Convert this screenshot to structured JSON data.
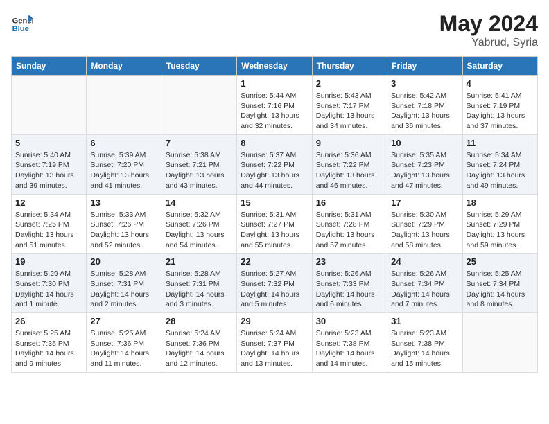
{
  "header": {
    "logo_line1": "General",
    "logo_line2": "Blue",
    "month_year": "May 2024",
    "location": "Yabrud, Syria"
  },
  "weekdays": [
    "Sunday",
    "Monday",
    "Tuesday",
    "Wednesday",
    "Thursday",
    "Friday",
    "Saturday"
  ],
  "weeks": [
    [
      {
        "day": "",
        "info": ""
      },
      {
        "day": "",
        "info": ""
      },
      {
        "day": "",
        "info": ""
      },
      {
        "day": "1",
        "info": "Sunrise: 5:44 AM\nSunset: 7:16 PM\nDaylight: 13 hours\nand 32 minutes."
      },
      {
        "day": "2",
        "info": "Sunrise: 5:43 AM\nSunset: 7:17 PM\nDaylight: 13 hours\nand 34 minutes."
      },
      {
        "day": "3",
        "info": "Sunrise: 5:42 AM\nSunset: 7:18 PM\nDaylight: 13 hours\nand 36 minutes."
      },
      {
        "day": "4",
        "info": "Sunrise: 5:41 AM\nSunset: 7:19 PM\nDaylight: 13 hours\nand 37 minutes."
      }
    ],
    [
      {
        "day": "5",
        "info": "Sunrise: 5:40 AM\nSunset: 7:19 PM\nDaylight: 13 hours\nand 39 minutes."
      },
      {
        "day": "6",
        "info": "Sunrise: 5:39 AM\nSunset: 7:20 PM\nDaylight: 13 hours\nand 41 minutes."
      },
      {
        "day": "7",
        "info": "Sunrise: 5:38 AM\nSunset: 7:21 PM\nDaylight: 13 hours\nand 43 minutes."
      },
      {
        "day": "8",
        "info": "Sunrise: 5:37 AM\nSunset: 7:22 PM\nDaylight: 13 hours\nand 44 minutes."
      },
      {
        "day": "9",
        "info": "Sunrise: 5:36 AM\nSunset: 7:22 PM\nDaylight: 13 hours\nand 46 minutes."
      },
      {
        "day": "10",
        "info": "Sunrise: 5:35 AM\nSunset: 7:23 PM\nDaylight: 13 hours\nand 47 minutes."
      },
      {
        "day": "11",
        "info": "Sunrise: 5:34 AM\nSunset: 7:24 PM\nDaylight: 13 hours\nand 49 minutes."
      }
    ],
    [
      {
        "day": "12",
        "info": "Sunrise: 5:34 AM\nSunset: 7:25 PM\nDaylight: 13 hours\nand 51 minutes."
      },
      {
        "day": "13",
        "info": "Sunrise: 5:33 AM\nSunset: 7:26 PM\nDaylight: 13 hours\nand 52 minutes."
      },
      {
        "day": "14",
        "info": "Sunrise: 5:32 AM\nSunset: 7:26 PM\nDaylight: 13 hours\nand 54 minutes."
      },
      {
        "day": "15",
        "info": "Sunrise: 5:31 AM\nSunset: 7:27 PM\nDaylight: 13 hours\nand 55 minutes."
      },
      {
        "day": "16",
        "info": "Sunrise: 5:31 AM\nSunset: 7:28 PM\nDaylight: 13 hours\nand 57 minutes."
      },
      {
        "day": "17",
        "info": "Sunrise: 5:30 AM\nSunset: 7:29 PM\nDaylight: 13 hours\nand 58 minutes."
      },
      {
        "day": "18",
        "info": "Sunrise: 5:29 AM\nSunset: 7:29 PM\nDaylight: 13 hours\nand 59 minutes."
      }
    ],
    [
      {
        "day": "19",
        "info": "Sunrise: 5:29 AM\nSunset: 7:30 PM\nDaylight: 14 hours\nand 1 minute."
      },
      {
        "day": "20",
        "info": "Sunrise: 5:28 AM\nSunset: 7:31 PM\nDaylight: 14 hours\nand 2 minutes."
      },
      {
        "day": "21",
        "info": "Sunrise: 5:28 AM\nSunset: 7:31 PM\nDaylight: 14 hours\nand 3 minutes."
      },
      {
        "day": "22",
        "info": "Sunrise: 5:27 AM\nSunset: 7:32 PM\nDaylight: 14 hours\nand 5 minutes."
      },
      {
        "day": "23",
        "info": "Sunrise: 5:26 AM\nSunset: 7:33 PM\nDaylight: 14 hours\nand 6 minutes."
      },
      {
        "day": "24",
        "info": "Sunrise: 5:26 AM\nSunset: 7:34 PM\nDaylight: 14 hours\nand 7 minutes."
      },
      {
        "day": "25",
        "info": "Sunrise: 5:25 AM\nSunset: 7:34 PM\nDaylight: 14 hours\nand 8 minutes."
      }
    ],
    [
      {
        "day": "26",
        "info": "Sunrise: 5:25 AM\nSunset: 7:35 PM\nDaylight: 14 hours\nand 9 minutes."
      },
      {
        "day": "27",
        "info": "Sunrise: 5:25 AM\nSunset: 7:36 PM\nDaylight: 14 hours\nand 11 minutes."
      },
      {
        "day": "28",
        "info": "Sunrise: 5:24 AM\nSunset: 7:36 PM\nDaylight: 14 hours\nand 12 minutes."
      },
      {
        "day": "29",
        "info": "Sunrise: 5:24 AM\nSunset: 7:37 PM\nDaylight: 14 hours\nand 13 minutes."
      },
      {
        "day": "30",
        "info": "Sunrise: 5:23 AM\nSunset: 7:38 PM\nDaylight: 14 hours\nand 14 minutes."
      },
      {
        "day": "31",
        "info": "Sunrise: 5:23 AM\nSunset: 7:38 PM\nDaylight: 14 hours\nand 15 minutes."
      },
      {
        "day": "",
        "info": ""
      }
    ]
  ]
}
